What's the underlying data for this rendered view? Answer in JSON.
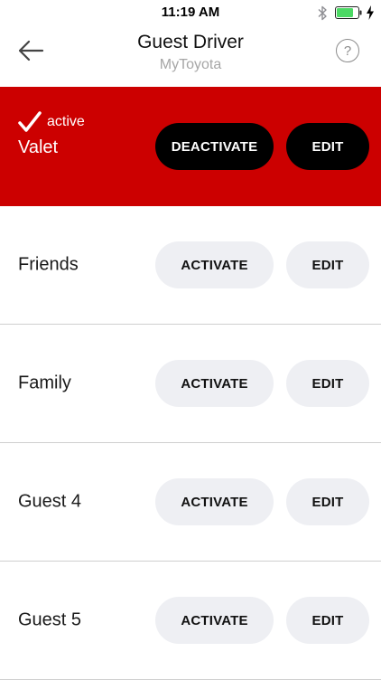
{
  "status_bar": {
    "time": "11:19 AM",
    "icons": [
      "bluetooth-icon",
      "battery-icon",
      "charging-icon"
    ],
    "battery_color": "#4cd964"
  },
  "header": {
    "title": "Guest Driver",
    "subtitle": "MyToyota",
    "help_label": "?",
    "back_icon": "arrow-left-icon"
  },
  "colors": {
    "active_bg": "#cc0000",
    "dark_button": "#000000",
    "light_button": "#eeeff3"
  },
  "profiles": [
    {
      "name": "Valet",
      "status": "active",
      "primary_label": "DEACTIVATE",
      "edit_label": "EDIT"
    },
    {
      "name": "Friends",
      "primary_label": "ACTIVATE",
      "edit_label": "EDIT"
    },
    {
      "name": "Family",
      "primary_label": "ACTIVATE",
      "edit_label": "EDIT"
    },
    {
      "name": "Guest 4",
      "primary_label": "ACTIVATE",
      "edit_label": "EDIT"
    },
    {
      "name": "Guest 5",
      "primary_label": "ACTIVATE",
      "edit_label": "EDIT"
    }
  ]
}
